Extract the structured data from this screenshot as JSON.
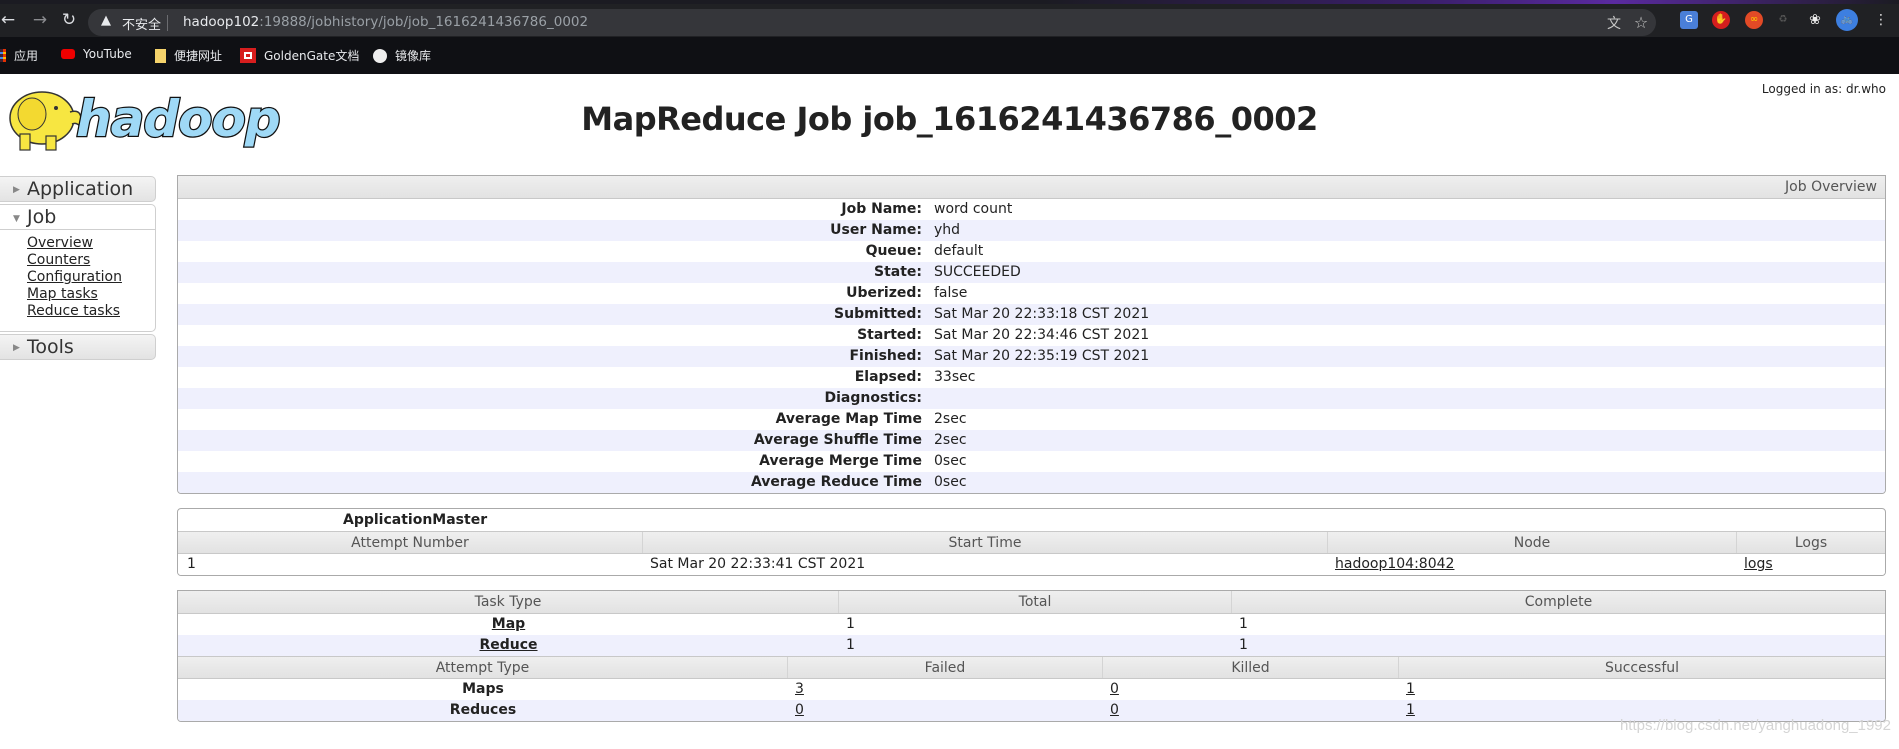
{
  "browser": {
    "insecure_label": "不安全",
    "url_host": "hadoop102",
    "url_rest": ":19888/jobhistory/job/job_1616241436786_0002",
    "bookmarks": [
      {
        "label": "应用",
        "icon": "apps-grid-icon"
      },
      {
        "label": "YouTube",
        "icon": "youtube-icon"
      },
      {
        "label": "便捷网址",
        "icon": "folder-icon"
      },
      {
        "label": "GoldenGate文档",
        "icon": "oracle-icon"
      },
      {
        "label": "镜像库",
        "icon": "globe-icon"
      }
    ]
  },
  "header": {
    "logged_in": "Logged in as: dr.who",
    "title": "MapReduce Job job_1616241436786_0002",
    "logo_text": "hadoop"
  },
  "sidebar": {
    "application": "Application",
    "job": "Job",
    "job_links": [
      "Overview",
      "Counters",
      "Configuration",
      "Map tasks",
      "Reduce tasks"
    ],
    "tools": "Tools"
  },
  "overview": {
    "header": "Job Overview",
    "rows": [
      {
        "key": "Job Name:",
        "value": "word count"
      },
      {
        "key": "User Name:",
        "value": "yhd"
      },
      {
        "key": "Queue:",
        "value": "default"
      },
      {
        "key": "State:",
        "value": "SUCCEEDED"
      },
      {
        "key": "Uberized:",
        "value": "false"
      },
      {
        "key": "Submitted:",
        "value": "Sat Mar 20 22:33:18 CST 2021"
      },
      {
        "key": "Started:",
        "value": "Sat Mar 20 22:34:46 CST 2021"
      },
      {
        "key": "Finished:",
        "value": "Sat Mar 20 22:35:19 CST 2021"
      },
      {
        "key": "Elapsed:",
        "value": "33sec"
      },
      {
        "key": "Diagnostics:",
        "value": ""
      },
      {
        "key": "Average Map Time",
        "value": "2sec"
      },
      {
        "key": "Average Shuffle Time",
        "value": "2sec"
      },
      {
        "key": "Average Merge Time",
        "value": "0sec"
      },
      {
        "key": "Average Reduce Time",
        "value": "0sec"
      }
    ]
  },
  "app_master": {
    "caption": "ApplicationMaster",
    "columns": [
      "Attempt Number",
      "Start Time",
      "Node",
      "Logs"
    ],
    "rows": [
      {
        "attempt": "1",
        "start_time": "Sat Mar 20 22:33:41 CST 2021",
        "node": "hadoop104:8042",
        "logs": "logs"
      }
    ]
  },
  "tasks": {
    "columns": [
      "Task Type",
      "Total",
      "Complete"
    ],
    "rows": [
      {
        "type": "Map",
        "total": "1",
        "complete": "1"
      },
      {
        "type": "Reduce",
        "total": "1",
        "complete": "1"
      }
    ],
    "attempt_columns": [
      "Attempt Type",
      "Failed",
      "Killed",
      "Successful"
    ],
    "attempt_rows": [
      {
        "type": "Maps",
        "failed": "3",
        "killed": "0",
        "successful": "1"
      },
      {
        "type": "Reduces",
        "failed": "0",
        "killed": "0",
        "successful": "1"
      }
    ]
  },
  "watermark": "https://blog.csdn.net/yanghuadong_1992"
}
